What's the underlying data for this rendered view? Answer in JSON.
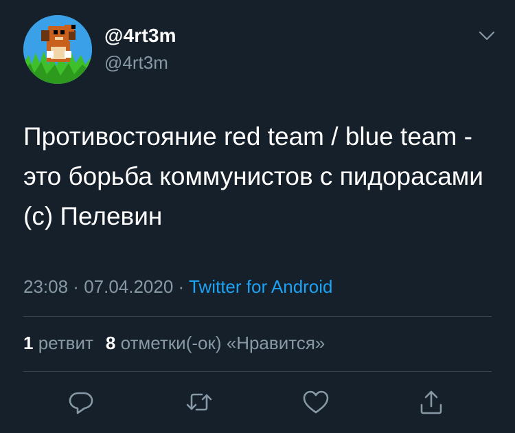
{
  "author": {
    "display_name": "@4rt3m",
    "handle": "@4rt3m"
  },
  "tweet": {
    "text": "Противостояние red team / blue team - это борьба коммунистов с пидорасами (с) Пелевин",
    "time": "23:08",
    "separator1": " · ",
    "date": "07.04.2020",
    "separator2": " · ",
    "source": "Twitter for Android"
  },
  "stats": {
    "retweets_count": "1",
    "retweets_label": "ретвит",
    "likes_count": "8",
    "likes_label": "отметки(-ок) «Нравится»"
  },
  "icons": {
    "menu": "chevron-down-icon",
    "reply": "reply-icon",
    "retweet": "retweet-icon",
    "like": "heart-icon",
    "share": "share-icon"
  },
  "colors": {
    "background": "#15202b",
    "text_primary": "#ffffff",
    "text_secondary": "#8899a6",
    "link": "#1da1f2",
    "divider": "#38444d"
  }
}
